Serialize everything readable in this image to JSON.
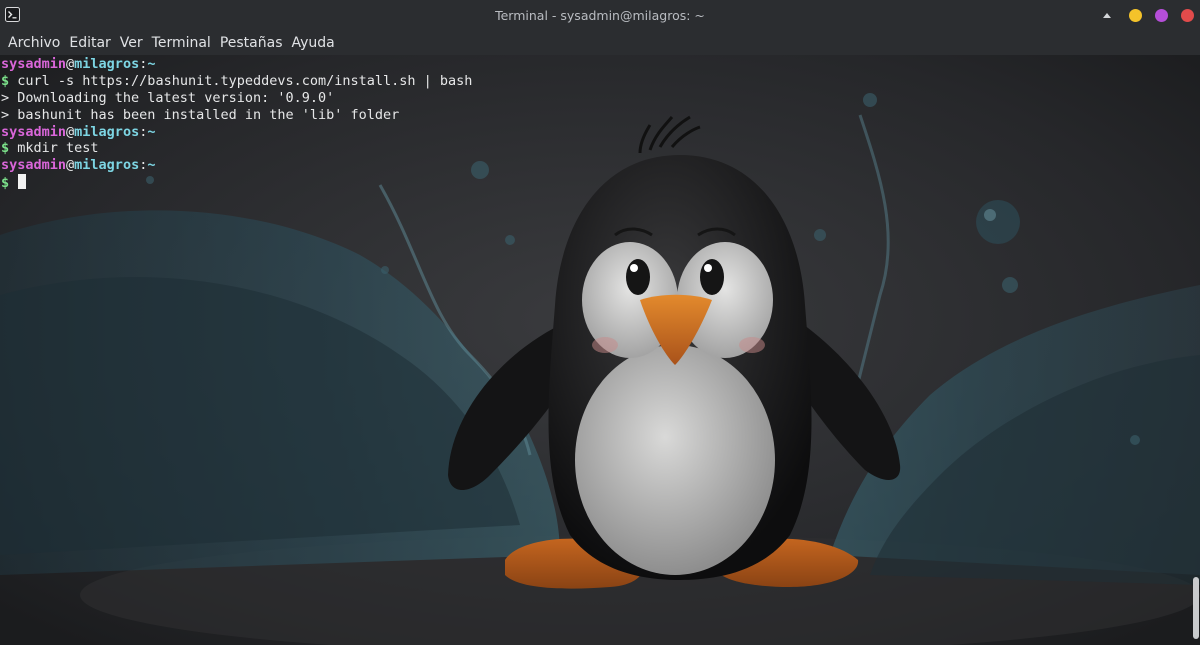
{
  "window": {
    "title": "Terminal - sysadmin@milagros: ~",
    "controls": {
      "minimize_color": "#f4c32a",
      "maximize_color": "#b54ed8",
      "close_color": "#e14b4b"
    }
  },
  "menu": {
    "items": [
      "Archivo",
      "Editar",
      "Ver",
      "Terminal",
      "Pestañas",
      "Ayuda"
    ]
  },
  "terminal": {
    "user": "sysadmin",
    "at": "@",
    "host": "milagros",
    "sep": ":",
    "path": "~",
    "prompt": "$",
    "lines": [
      {
        "type": "prompt"
      },
      {
        "type": "cmd",
        "text": " curl -s https://bashunit.typeddevs.com/install.sh | bash"
      },
      {
        "type": "out",
        "text": "> Downloading the latest version: '0.9.0'"
      },
      {
        "type": "out",
        "text": "> bashunit has been installed in the 'lib' folder"
      },
      {
        "type": "prompt"
      },
      {
        "type": "cmd",
        "text": " mkdir test"
      },
      {
        "type": "prompt"
      },
      {
        "type": "cursor",
        "text": " "
      }
    ]
  }
}
